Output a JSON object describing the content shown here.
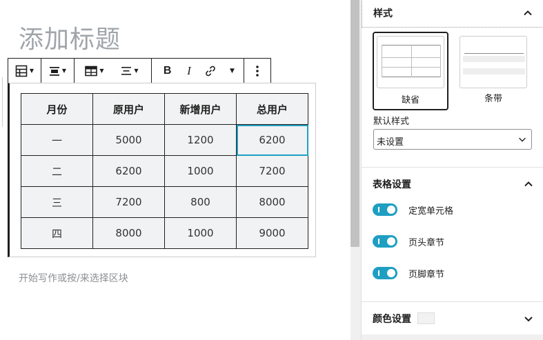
{
  "editor": {
    "title_placeholder": "添加标题",
    "append_placeholder": "开始写作或按/来选择区块"
  },
  "toolbar": {
    "buttons": [
      {
        "name": "table-block-type",
        "icon": "table-icon"
      },
      {
        "name": "align",
        "icon": "align-center-icon"
      },
      {
        "name": "edit-table",
        "icon": "table-edit-icon"
      },
      {
        "name": "text-align",
        "icon": "text-align-center-icon"
      },
      {
        "name": "bold",
        "label": "B"
      },
      {
        "name": "italic",
        "label": "I"
      },
      {
        "name": "link",
        "icon": "link-icon"
      },
      {
        "name": "more-rich-text",
        "icon": "chevron-down-icon"
      },
      {
        "name": "more-options",
        "icon": "vertical-ellipsis-icon"
      }
    ]
  },
  "table": {
    "headers": [
      "月份",
      "原用户",
      "新增用户",
      "总用户"
    ],
    "rows": [
      [
        "一",
        "5000",
        "1200",
        "6200"
      ],
      [
        "二",
        "6200",
        "1000",
        "7200"
      ],
      [
        "三",
        "7200",
        "800",
        "8000"
      ],
      [
        "四",
        "8000",
        "1000",
        "9000"
      ]
    ],
    "selected_cell": "row-1-col-4"
  },
  "sidebar": {
    "styles_panel": {
      "title": "样式",
      "options": [
        {
          "label": "缺省",
          "selected": true
        },
        {
          "label": "条带",
          "selected": false
        }
      ],
      "default_style_label": "默认样式",
      "default_style_value": "未设置"
    },
    "table_settings_panel": {
      "title": "表格设置",
      "toggles": [
        {
          "label": "定宽单元格",
          "checked": true
        },
        {
          "label": "页头章节",
          "checked": true
        },
        {
          "label": "页脚章节",
          "checked": true
        }
      ]
    },
    "color_settings_panel": {
      "title": "颜色设置",
      "swatch_color": "#f2f2f2"
    }
  },
  "colors": {
    "accent": "#1e9fc2",
    "table_cell_bg": "#f1f2f3",
    "border_dark": "#1e1e1e"
  }
}
